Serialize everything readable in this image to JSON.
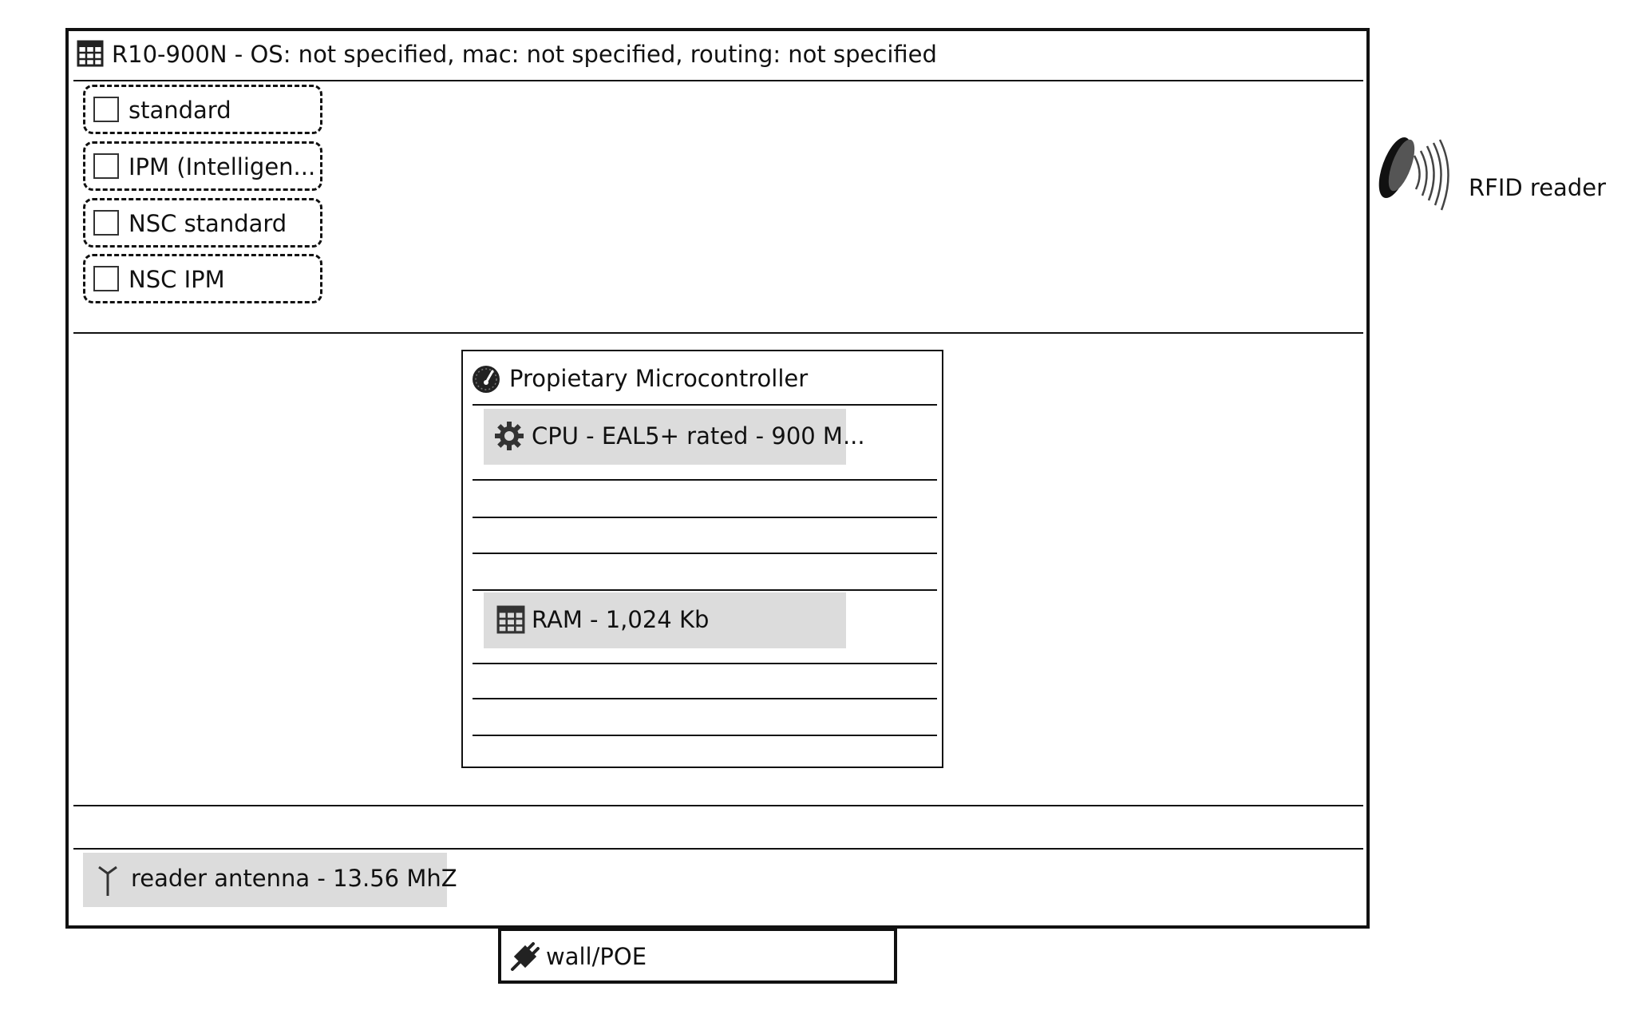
{
  "device": {
    "title": "R10-900N - OS: not specified, mac: not specified, routing: not specified",
    "icon": "grid-table-icon"
  },
  "options": [
    {
      "label": "standard",
      "checked": false
    },
    {
      "label": "IPM (Intelligen...",
      "checked": false
    },
    {
      "label": "NSC standard",
      "checked": false
    },
    {
      "label": "NSC IPM",
      "checked": false
    }
  ],
  "microcontroller": {
    "title": "Propietary Microcontroller",
    "icon": "speedometer-icon",
    "cpu": {
      "label": "CPU - EAL5+ rated - 900 M...",
      "icon": "gear-icon"
    },
    "ram": {
      "label": "RAM - 1,024 Kb",
      "icon": "grid-table-icon"
    }
  },
  "antenna": {
    "label": "reader antenna - 13.56 MhZ",
    "icon": "antenna-icon"
  },
  "power": {
    "label": "wall/POE",
    "icon": "plug-icon"
  },
  "rfid": {
    "label": "RFID reader",
    "icon": "rfid-wave-icon"
  },
  "colors": {
    "border": "#111111",
    "chip_fill": "#dcdcdc",
    "background": "#ffffff"
  }
}
